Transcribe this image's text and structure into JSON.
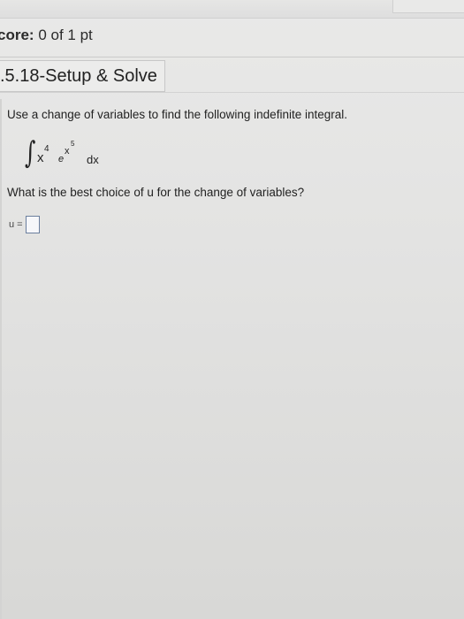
{
  "header": {
    "score_label": "core:",
    "score_value": "0 of 1 pt"
  },
  "problem": {
    "title": ".5.18-Setup & Solve",
    "instruction": "Use a change of variables to find the following indefinite integral.",
    "integral": {
      "sign": "∫",
      "base": "x",
      "base_exponent": "4",
      "exp_base": "e",
      "exp_power_base": "x",
      "exp_power_exponent": "5",
      "differential": "dx"
    },
    "question": "What is the best choice of u for the change of variables?",
    "answer": {
      "label": "u =",
      "value": ""
    }
  }
}
